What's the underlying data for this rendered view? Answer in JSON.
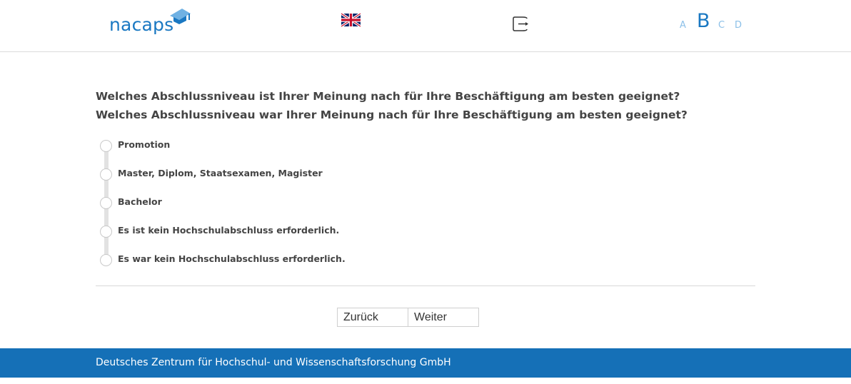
{
  "header": {
    "logo_text": "nacaps",
    "language_flag": "uk-flag-icon",
    "logout_icon": "logout-icon",
    "font_sizes": [
      "A",
      "B",
      "C",
      "D"
    ],
    "active_font_size": "B"
  },
  "question": {
    "line1": "Welches Abschlussniveau ist Ihrer Meinung nach für Ihre Beschäftigung am besten geeignet?",
    "line2": "Welches Abschlussniveau war Ihrer Meinung nach für Ihre Beschäftigung am besten geeignet?"
  },
  "options": [
    {
      "label": "Promotion",
      "selected": false
    },
    {
      "label": "Master, Diplom, Staatsexamen, Magister",
      "selected": false
    },
    {
      "label": "Bachelor",
      "selected": false
    },
    {
      "label": "Es ist kein Hochschulabschluss erforderlich.",
      "selected": false
    },
    {
      "label": "Es war kein Hochschulabschluss erforderlich.",
      "selected": false
    }
  ],
  "nav": {
    "back_label": "Zurück",
    "next_label": "Weiter"
  },
  "footer": {
    "text": "Deutsches Zentrum für Hochschul- und Wissenschaftsforschung GmbH"
  },
  "colors": {
    "brand_blue": "#1570b7",
    "logo_blue": "#1a78c2",
    "inactive_font_size": "#8cc0e8"
  }
}
